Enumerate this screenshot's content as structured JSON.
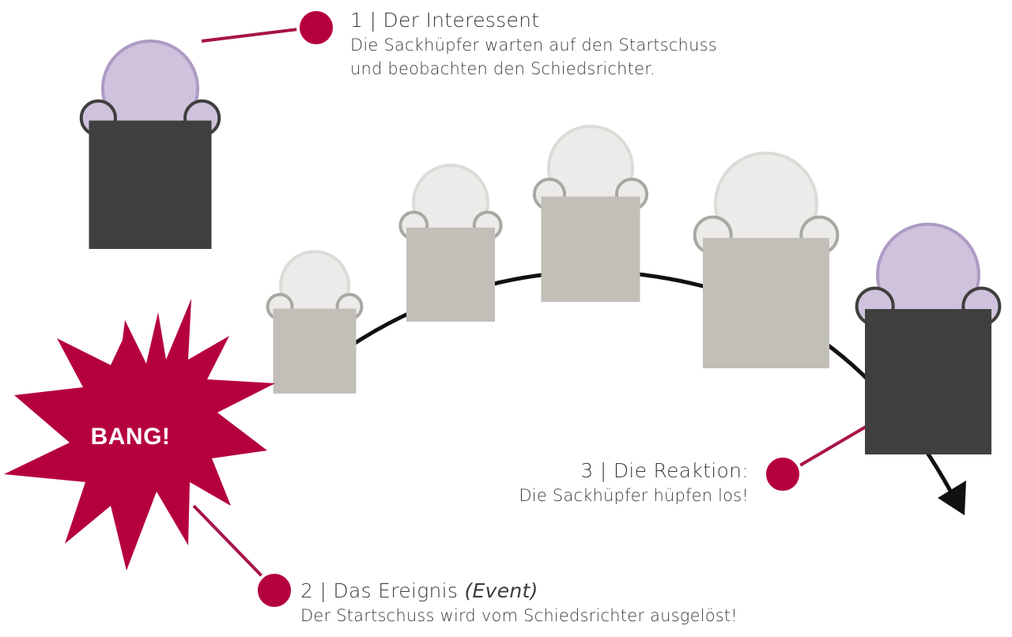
{
  "colors": {
    "accent": "#b5003f",
    "connector": "#a8124a",
    "dark_body": "#3f3f3f",
    "purple_head": "#cfc2dc",
    "purple_neck": "#ad9bc4",
    "grey_body": "#c1bfb8",
    "grey_head": "#ecebe9",
    "grey_neck": "#dcdbd7",
    "arc": "#111111"
  },
  "burst": {
    "text": "BANG!"
  },
  "steps": [
    {
      "number": "1",
      "separator": "|",
      "title": "Der Interessent",
      "description_line1": "Die Sackhüpfer warten auf den Startschuss",
      "description_line2": "und beobachten den Schiedsrichter."
    },
    {
      "number": "2",
      "separator": "|",
      "title": "Das Ereignis ",
      "title_em": "(Event)",
      "description_line1": "Der Startschuss wird vom Schiedsrichter ausgelöst!"
    },
    {
      "number": "3",
      "separator": "|",
      "title": "Die Reaktion:",
      "description_line1": "Die Sackhüpfer hüpfen los!"
    }
  ],
  "step_titles": {
    "s1": "1 | Der Interessent",
    "s2": "2 | Das Ereignis ",
    "s2_em": "(Event)",
    "s3": "3 | Die Reaktion:"
  },
  "figures": [
    {
      "name": "interessent-figure",
      "style": "purple"
    },
    {
      "name": "hopper-1",
      "style": "grey"
    },
    {
      "name": "hopper-2",
      "style": "grey"
    },
    {
      "name": "hopper-3",
      "style": "grey"
    },
    {
      "name": "hopper-4",
      "style": "grey"
    },
    {
      "name": "hopper-5",
      "style": "purple"
    }
  ]
}
